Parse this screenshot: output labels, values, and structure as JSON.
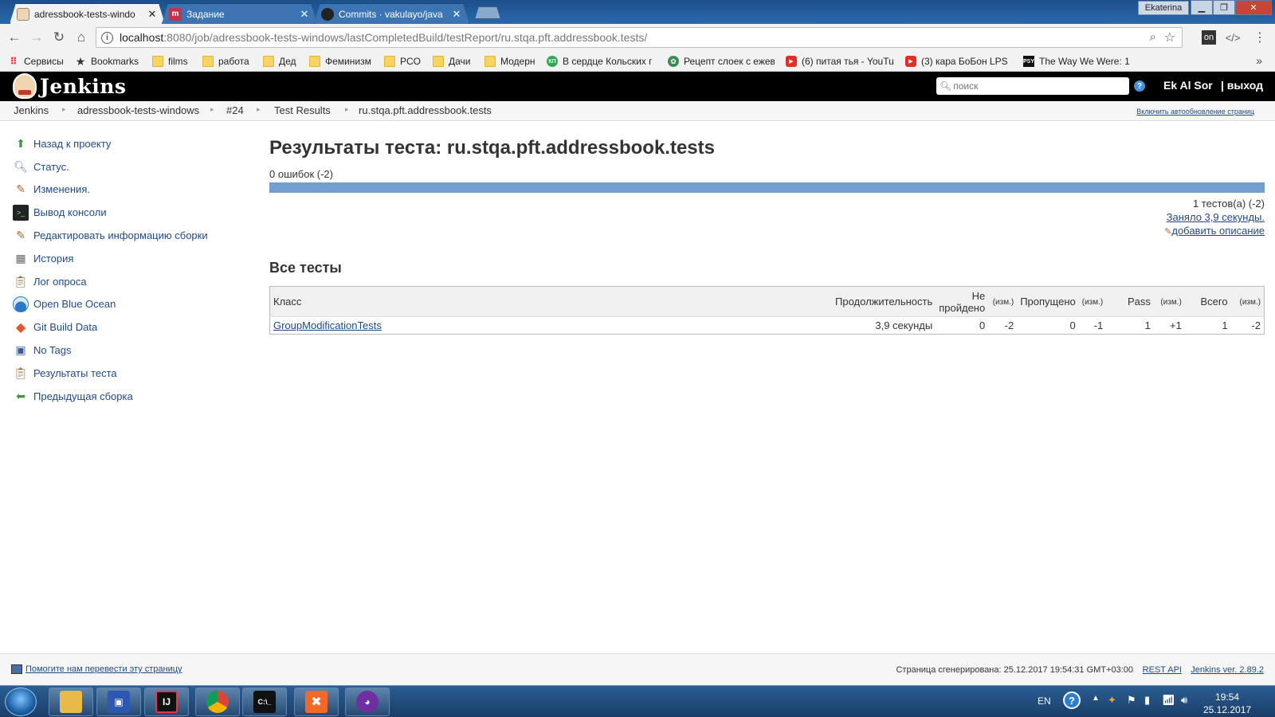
{
  "browser": {
    "tabs": [
      {
        "title": "adressbook-tests-windo",
        "active": true,
        "favicon": "jenkins-butler-icon"
      },
      {
        "title": "Задание",
        "active": false,
        "favicon": "m-logo-icon"
      },
      {
        "title": "Commits · vakulayo/java",
        "active": false,
        "favicon": "github-icon"
      }
    ],
    "window_user": "Ekaterina",
    "url_host": "localhost",
    "url_rest": ":8080/job/adressbook-tests-windows/lastCompletedBuild/testReport/ru.stqa.pft.addressbook.tests/",
    "bookmarks": [
      {
        "label": "Сервисы",
        "icon": "apps-grid-icon"
      },
      {
        "label": "Bookmarks",
        "icon": "star-icon"
      },
      {
        "label": "films",
        "icon": "folder-icon"
      },
      {
        "label": "работа",
        "icon": "folder-icon"
      },
      {
        "label": "Дед",
        "icon": "folder-icon"
      },
      {
        "label": "Феминизм",
        "icon": "folder-icon"
      },
      {
        "label": "PCO",
        "icon": "folder-icon"
      },
      {
        "label": "Дачи",
        "icon": "folder-icon"
      },
      {
        "label": "Модерн",
        "icon": "folder-icon"
      },
      {
        "label": "В сердце Кольских г",
        "icon": "kp-icon"
      },
      {
        "label": "Рецепт слоек с ежев",
        "icon": "recipe-icon"
      },
      {
        "label": "(6) питая тья - YouTu",
        "icon": "youtube-icon"
      },
      {
        "label": "(3) кара БоБон LPS :",
        "icon": "youtube-icon"
      },
      {
        "label": "The Way We Were: 1",
        "icon": "psy-icon"
      }
    ]
  },
  "jenkins": {
    "logo": "Jenkins",
    "search_placeholder": "поиск",
    "user": "Ek Al Sor",
    "logout": "| выход",
    "breadcrumbs": [
      "Jenkins",
      "adressbook-tests-windows",
      "#24",
      "Test Results",
      "ru.stqa.pft.addressbook.tests"
    ],
    "autorefresh": "Включить автообновление страниц",
    "tasks": [
      {
        "label": "Назад к проекту",
        "icon": "up-arrow-icon"
      },
      {
        "label": "Статус.",
        "icon": "magnifier-icon"
      },
      {
        "label": "Изменения.",
        "icon": "notepad-icon"
      },
      {
        "label": "Вывод консоли",
        "icon": "terminal-icon"
      },
      {
        "label": "Редактировать информацию сборки",
        "icon": "notepad-icon"
      },
      {
        "label": "История",
        "icon": "history-icon"
      },
      {
        "label": "Лог опроса",
        "icon": "clipboard-icon"
      },
      {
        "label": "Open Blue Ocean",
        "icon": "blue-ocean-icon"
      },
      {
        "label": "Git Build Data",
        "icon": "git-icon"
      },
      {
        "label": "No Tags",
        "icon": "save-icon"
      },
      {
        "label": "Результаты теста",
        "icon": "clipboard-icon"
      },
      {
        "label": "Предыдущая сборка",
        "icon": "left-arrow-icon"
      }
    ],
    "page_title": "Результаты теста: ru.stqa.pft.addressbook.tests",
    "fail_count": "0 ошибок (-2)",
    "progress_pass_fraction": 1.0,
    "test_count": "1 тестов(а) (-2)",
    "duration_link": "Заняло 3,9 секунды.",
    "add_description": "добавить описание",
    "all_tests_heading": "Все тесты",
    "table": {
      "headers": {
        "cls": "Класс",
        "duration": "Продолжительность",
        "fail_1": "Не",
        "fail_2": "пройдено",
        "diff": "(изм.)",
        "skip": "Пропущено",
        "pass": "Pass",
        "total": "Всего"
      },
      "rows": [
        {
          "cls": "GroupModificationTests",
          "duration": "3,9 секунды",
          "fail": "0",
          "fail_diff": "-2",
          "skip": "0",
          "skip_diff": "-1",
          "pass": "1",
          "pass_diff": "+1",
          "total": "1",
          "total_diff": "-2"
        }
      ]
    },
    "footer": {
      "translate": "Помогите нам перевести эту страницу",
      "generated": "Страница сгенерирована: 25.12.2017 19:54:31 GMT+03:00",
      "rest_api": "REST API",
      "version": "Jenkins ver. 2.89.2"
    }
  },
  "taskbar": {
    "apps": [
      {
        "name": "explorer",
        "icon": "folder-icon",
        "color": "#e9b949"
      },
      {
        "name": "notepad",
        "icon": "floppy-icon",
        "color": "#2d58b2"
      },
      {
        "name": "intellij",
        "icon": "intellij-icon",
        "color": "#111111",
        "text": "IJ"
      },
      {
        "name": "chrome",
        "icon": "chrome-icon",
        "color": "#db4437"
      },
      {
        "name": "cmd",
        "icon": "terminal-icon",
        "color": "#111111",
        "text": "C:\\_"
      },
      {
        "name": "xampp",
        "icon": "xampp-icon",
        "color": "#f16a2a"
      },
      {
        "name": "github-desktop",
        "icon": "octocat-icon",
        "color": "#6e2fa0"
      }
    ],
    "lang": "EN",
    "time": "19:54",
    "date": "25.12.2017"
  },
  "colors": {
    "jenkins_header": "#000000",
    "link": "#204a87",
    "progress_pass": "#729fcf"
  }
}
